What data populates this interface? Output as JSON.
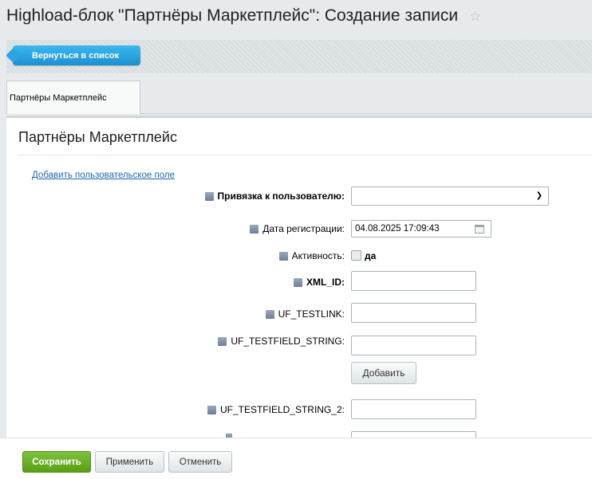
{
  "header": {
    "title": "Highload-блок \"Партнёры Маркетплейс\": Создание записи",
    "star": "☆"
  },
  "toolbar": {
    "back_label": "Вернуться в список"
  },
  "tabs": [
    {
      "label": "Партнёры Маркетплейс"
    }
  ],
  "panel": {
    "title": "Партнёры Маркетплейс",
    "add_field_link": "Добавить пользовательское поле"
  },
  "form": {
    "user_link": {
      "label": "Привязка к пользователю:",
      "value": ""
    },
    "reg_date": {
      "label": "Дата регистрации:",
      "value": "04.08.2025 17:09:43"
    },
    "active": {
      "label": "Активность:",
      "option": "да",
      "checked": false
    },
    "xml_id": {
      "label": "XML_ID:",
      "value": ""
    },
    "uf_testlink": {
      "label": "UF_TESTLINK:",
      "value": ""
    },
    "uf_testfield_string": {
      "label": "UF_TESTFIELD_STRING:",
      "value": ""
    },
    "add_button": "Добавить",
    "uf_testfield_string_2": {
      "label": "UF_TESTFIELD_STRING_2:",
      "value": ""
    }
  },
  "footer": {
    "save": "Сохранить",
    "apply": "Применить",
    "cancel": "Отменить"
  },
  "colors": {
    "accent_blue": "#1e8fd1",
    "save_green": "#59a016",
    "link": "#2067b0"
  }
}
